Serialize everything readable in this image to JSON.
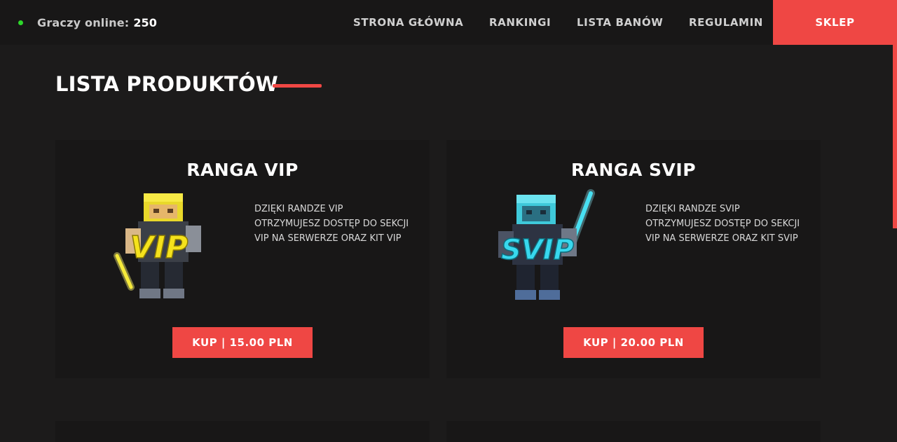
{
  "header": {
    "online_label": "Graczy online:",
    "online_count": "250",
    "nav": [
      "STRONA GŁÓWNA",
      "RANKINGI",
      "LISTA BANÓW",
      "REGULAMIN"
    ],
    "shop_label": "SKLEP"
  },
  "section": {
    "title": "LISTA PRODUKTÓW"
  },
  "products": [
    {
      "title": "RANGA VIP",
      "art_text": "VIP",
      "description": "DZIĘKI RANDZE VIP OTRZYMUJESZ DOSTĘP DO SEKCJI VIP NA SERWERZE ORAZ KIT VIP",
      "button": "KUP | 15.00 PLN",
      "color": "#f5e21c"
    },
    {
      "title": "RANGA SVIP",
      "art_text": "SVIP",
      "description": "DZIĘKI RANDZE SVIP OTRZYMUJESZ DOSTĘP DO SEKCJI VIP NA SERWERZE ORAZ KIT SVIP",
      "button": "KUP | 20.00 PLN",
      "color": "#38d8ee"
    }
  ],
  "colors": {
    "accent": "#ef4744",
    "online": "#2dd72a",
    "background": "#1c1b1b",
    "card": "#181717"
  }
}
